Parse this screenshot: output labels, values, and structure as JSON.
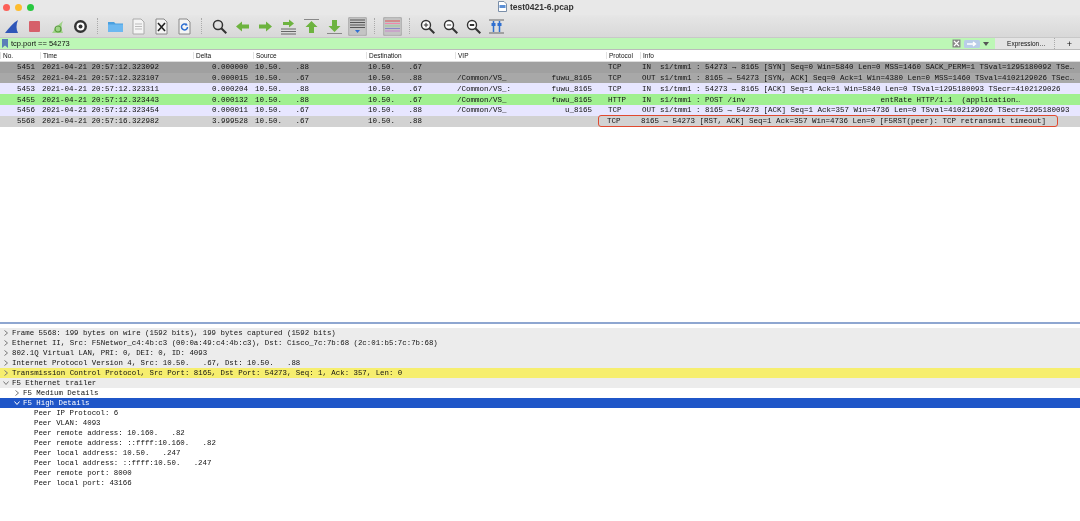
{
  "window": {
    "title": "test0421-6.pcap"
  },
  "toolbar": [
    {
      "kind": "fin",
      "on": false
    },
    {
      "kind": "stop",
      "on": false
    },
    {
      "kind": "restart",
      "on": false
    },
    {
      "kind": "gear",
      "on": false
    },
    {
      "kind": "sep"
    },
    {
      "kind": "folder",
      "on": false
    },
    {
      "kind": "file",
      "on": false
    },
    {
      "kind": "closefile",
      "on": false
    },
    {
      "kind": "reload",
      "on": false
    },
    {
      "kind": "sep"
    },
    {
      "kind": "search",
      "on": false
    },
    {
      "kind": "left",
      "on": false
    },
    {
      "kind": "right",
      "on": false
    },
    {
      "kind": "jump",
      "on": false
    },
    {
      "kind": "up",
      "on": false
    },
    {
      "kind": "down",
      "on": false
    },
    {
      "kind": "autoscroll",
      "on": true
    },
    {
      "kind": "sep"
    },
    {
      "kind": "colorize",
      "on": true
    },
    {
      "kind": "sep"
    },
    {
      "kind": "zoomin",
      "on": false
    },
    {
      "kind": "zoomout",
      "on": false
    },
    {
      "kind": "zoomreset",
      "on": false
    },
    {
      "kind": "columns",
      "on": false
    }
  ],
  "filter": {
    "value": "tcp.port == 54273",
    "expression_button": "Expression…",
    "add_button": "+"
  },
  "packet_list": {
    "columns": [
      "No.",
      "Time",
      "Delta",
      "Source",
      "Destination",
      "VIP",
      "Protocol",
      "Info"
    ],
    "rows": [
      {
        "no": "5451",
        "time": "2021-04-21 20:57:12.323092",
        "delta": "0.000000",
        "source": "10.50.   .88",
        "destination": "10.50.   .67",
        "vip": "",
        "protocol": "TCP",
        "info": "IN  s1/tmm1 : 54273 → 8165 [SYN] Seq=0 Win=5840 Len=0 MSS=1460 SACK_PERM=1 TSval=1295180092 TSe…",
        "color": "#a0a0a0",
        "flagged": false
      },
      {
        "no": "5452",
        "time": "2021-04-21 20:57:12.323107",
        "delta": "0.000015",
        "source": "10.50.   .67",
        "destination": "10.50.   .88",
        "vip": "/Common/VS_          fuwu_8165",
        "protocol": "TCP",
        "info": "OUT s1/tmm1 : 8165 → 54273 [SYN, ACK] Seq=0 Ack=1 Win=4380 Len=0 MSS=1460 TSval=4102129026 TSec…",
        "color": "#a8a8a8",
        "flagged": false
      },
      {
        "no": "5453",
        "time": "2021-04-21 20:57:12.323311",
        "delta": "0.000204",
        "source": "10.50.   .88",
        "destination": "10.50.   .67",
        "vip": "/Common/VS_:         fuwu_8165",
        "protocol": "TCP",
        "info": "IN  s1/tmm1 : 54273 → 8165 [ACK] Seq=1 Ack=1 Win=5840 Len=0 TSval=1295180093 TSecr=4102129026",
        "color": "#e7e6ff",
        "flagged": false
      },
      {
        "no": "5455",
        "time": "2021-04-21 20:57:12.323443",
        "delta": "0.000132",
        "source": "10.50.   .88",
        "destination": "10.50.   .67",
        "vip": "/Common/VS_          fuwu_8165",
        "protocol": "HTTP",
        "info": "IN  s1/tmm1 : POST /inv                              entRate HTTP/1.1  (application…",
        "color": "#a0f090",
        "flagged": false
      },
      {
        "no": "5456",
        "time": "2021-04-21 20:57:12.323454",
        "delta": "0.000011",
        "source": "10.50.   .67",
        "destination": "10.50.   .88",
        "vip": "/Common/VS_             u_8165",
        "protocol": "TCP",
        "info": "OUT s1/tmm1 : 8165 → 54273 [ACK] Seq=1 Ack=357 Win=4736 Len=0 TSval=4102129026 TSecr=1295180093",
        "color": "#e7e6ff",
        "flagged": false
      },
      {
        "no": "5568",
        "time": "2021-04-21 20:57:16.322982",
        "delta": "3.999528",
        "source": "10.50.   .67",
        "destination": "10.50.   .88",
        "vip": "",
        "protocol": "TCP",
        "info": "8165 → 54273 [RST, ACK] Seq=1 Ack=357 Win=4736 Len=0 [F5RST(peer): TCP retransmit timeout]",
        "color": "#d2d2d2",
        "flagged": true
      }
    ]
  },
  "details": [
    {
      "label": "Frame 5568: 199 bytes on wire (1592 bits), 199 bytes captured (1592 bits)",
      "expanded": false,
      "selected": false,
      "color": "#ececec"
    },
    {
      "label": "Ethernet II, Src: F5Networ_c4:4b:c3 (00:0a:49:c4:4b:c3), Dst: Cisco_7c:7b:68 (2c:01:b5:7c:7b:68)",
      "expanded": false,
      "selected": false,
      "color": "#ececec"
    },
    {
      "label": "802.1Q Virtual LAN, PRI: 0, DEI: 0, ID: 4093",
      "expanded": false,
      "selected": false,
      "color": "#ececec"
    },
    {
      "label": "Internet Protocol Version 4, Src: 10.50.   .67, Dst: 10.50.   .88",
      "expanded": false,
      "selected": false,
      "color": "#ececec"
    },
    {
      "label": "Transmission Control Protocol, Src Port: 8165, Dst Port: 54273, Seq: 1, Ack: 357, Len: 0",
      "expanded": false,
      "selected": false,
      "color": "#f6ee6e"
    },
    {
      "label": "F5 Ethernet trailer",
      "expanded": true,
      "selected": false,
      "color": "#ececec",
      "children": [
        {
          "label": "F5 Medium Details",
          "expanded": false,
          "selected": false
        },
        {
          "label": "F5 High Details",
          "expanded": true,
          "selected": true,
          "children": [
            {
              "label": "Peer IP Protocol: 6",
              "selected": false
            },
            {
              "label": "Peer VLAN: 4093",
              "selected": false
            },
            {
              "label": "Peer remote address: 10.160.   .82",
              "selected": false
            },
            {
              "label": "Peer remote address: ::ffff:10.160.   .82",
              "selected": false
            },
            {
              "label": "Peer local address: 10.50.   .247",
              "selected": false
            },
            {
              "label": "Peer local address: ::ffff:10.50.   .247",
              "selected": false
            },
            {
              "label": "Peer remote port: 8000",
              "selected": false
            },
            {
              "label": "Peer local port: 43166",
              "selected": false
            }
          ]
        }
      ]
    }
  ]
}
